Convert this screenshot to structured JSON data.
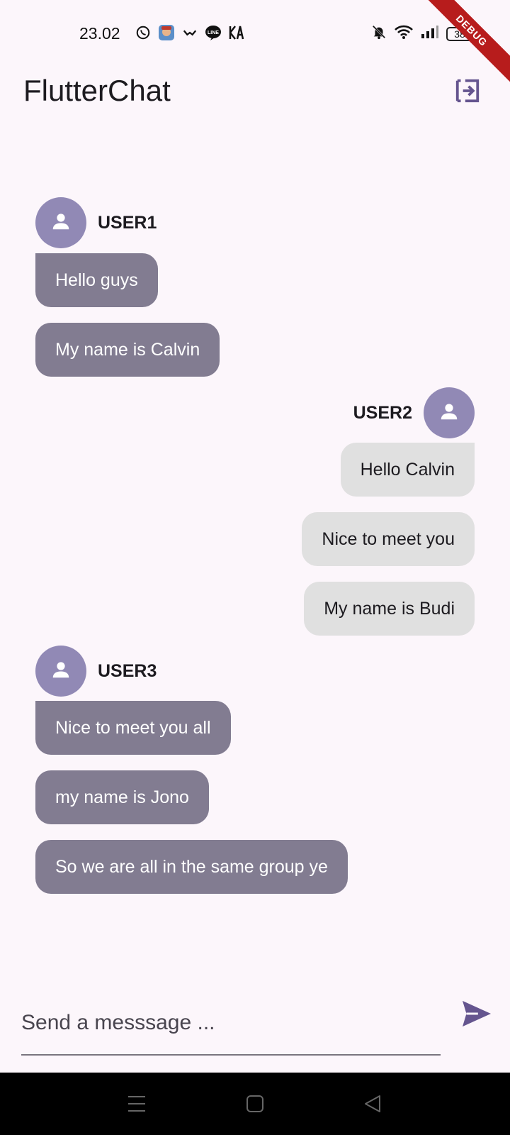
{
  "status_bar": {
    "time": "23.02",
    "app_icons": [
      "whatsapp-icon",
      "game-avatar-icon",
      "chat-bubble-icon",
      "line-icon",
      "kai-icon"
    ],
    "battery": "38",
    "debug_label": "DEBUG"
  },
  "app_bar": {
    "title": "FlutterChat",
    "action_icon": "logout-icon"
  },
  "messages": [
    {
      "user": "USER1",
      "text": "Hello guys",
      "side": "left"
    },
    {
      "user": "USER1",
      "text": "My name is Calvin",
      "side": "left"
    },
    {
      "user": "USER2",
      "text": "Hello Calvin",
      "side": "right"
    },
    {
      "user": "USER2",
      "text": "Nice to meet you",
      "side": "right"
    },
    {
      "user": "USER2",
      "text": "My name is Budi",
      "side": "right"
    },
    {
      "user": "USER3",
      "text": "Nice to meet you all",
      "side": "left"
    },
    {
      "user": "USER3",
      "text": "my name is Jono",
      "side": "left"
    },
    {
      "user": "USER3",
      "text": "So we are all in the same group ye",
      "side": "left"
    }
  ],
  "input": {
    "placeholder": "Send a messsage ...",
    "value": "",
    "send_icon": "send-icon"
  },
  "colors": {
    "accent": "#65558f",
    "avatar": "#9189b5",
    "bubble_other": "#827c91",
    "bubble_self": "#e0e0e0",
    "background": "#fcf6fb"
  }
}
